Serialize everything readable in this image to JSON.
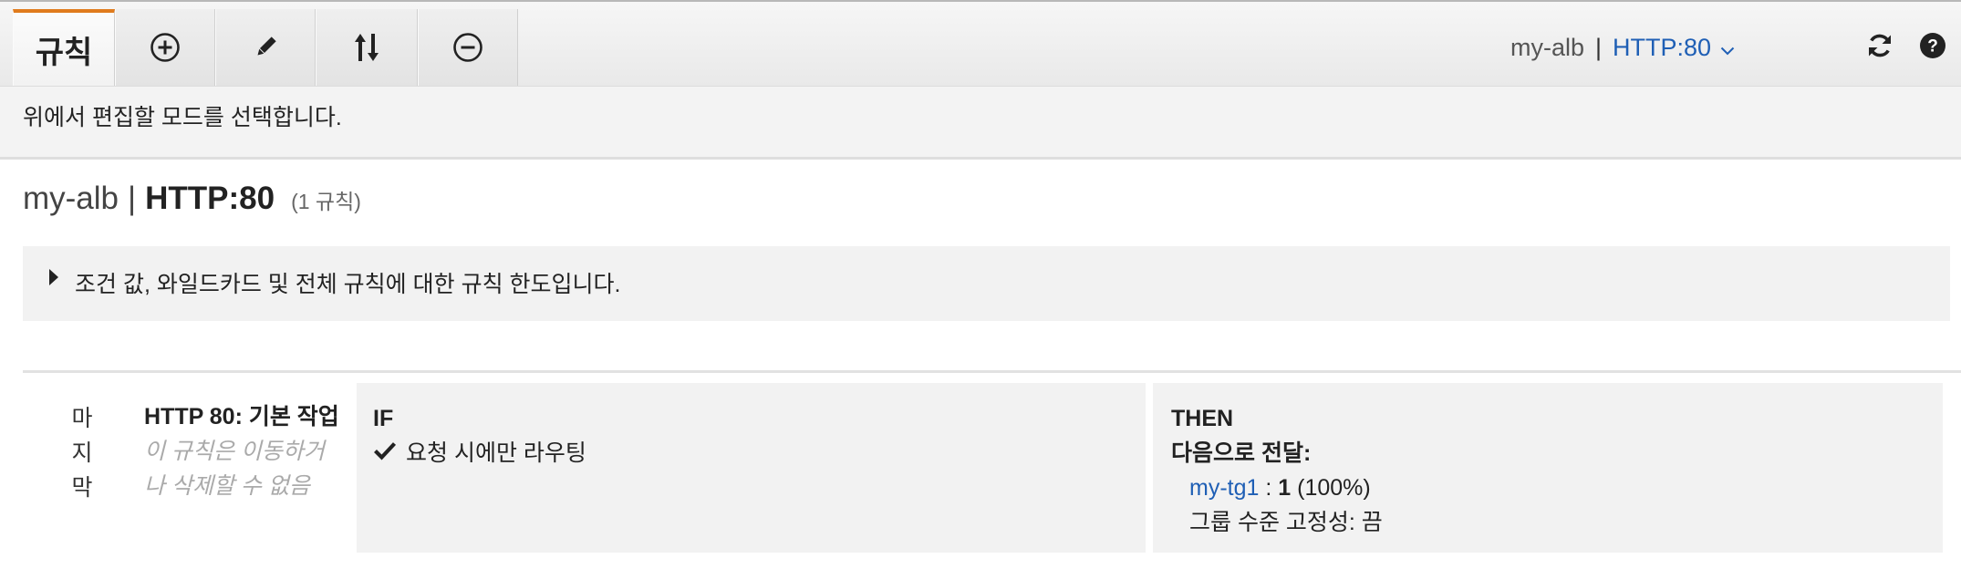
{
  "toolbar": {
    "tabs": [
      {
        "label": "규칙",
        "icon": "",
        "active": true
      },
      {
        "label": "",
        "icon": "add-icon"
      },
      {
        "label": "",
        "icon": "pencil-icon"
      },
      {
        "label": "",
        "icon": "reorder-icon"
      },
      {
        "label": "",
        "icon": "remove-icon"
      }
    ],
    "load_balancer": "my-alb",
    "separator": "|",
    "listener": "HTTP:80",
    "listener_chevron": "chevron-down-icon",
    "refresh_icon": "refresh-icon",
    "help_icon": "help-icon"
  },
  "info": {
    "text": "위에서 편집할 모드를 선택합니다."
  },
  "heading": {
    "load_balancer": "my-alb",
    "separator": "|",
    "listener": "HTTP:80",
    "rule_count": "(1 규칙)"
  },
  "limits": {
    "text": "조건 값, 와일드카드 및 전체 규칙에 대한 규칙 한도입니다."
  },
  "rule": {
    "position": [
      "마",
      "지",
      "막"
    ],
    "title": "HTTP 80: 기본 작업",
    "note": "이 규칙은 이동하거나 삭제할 수 없음",
    "if": {
      "title": "IF",
      "condition": "요청 시에만 라우팅"
    },
    "then": {
      "title": "THEN",
      "forward_label": "다음으로 전달:",
      "target_group": "my-tg1",
      "colon": ":",
      "weight": "1",
      "percent": "(100%)",
      "stickiness": "그룹 수준 고정성: 끔"
    }
  },
  "colors": {
    "accent_tab": "#e07b1d",
    "link": "#1f5fb5",
    "panel": "#f2f2f2"
  }
}
